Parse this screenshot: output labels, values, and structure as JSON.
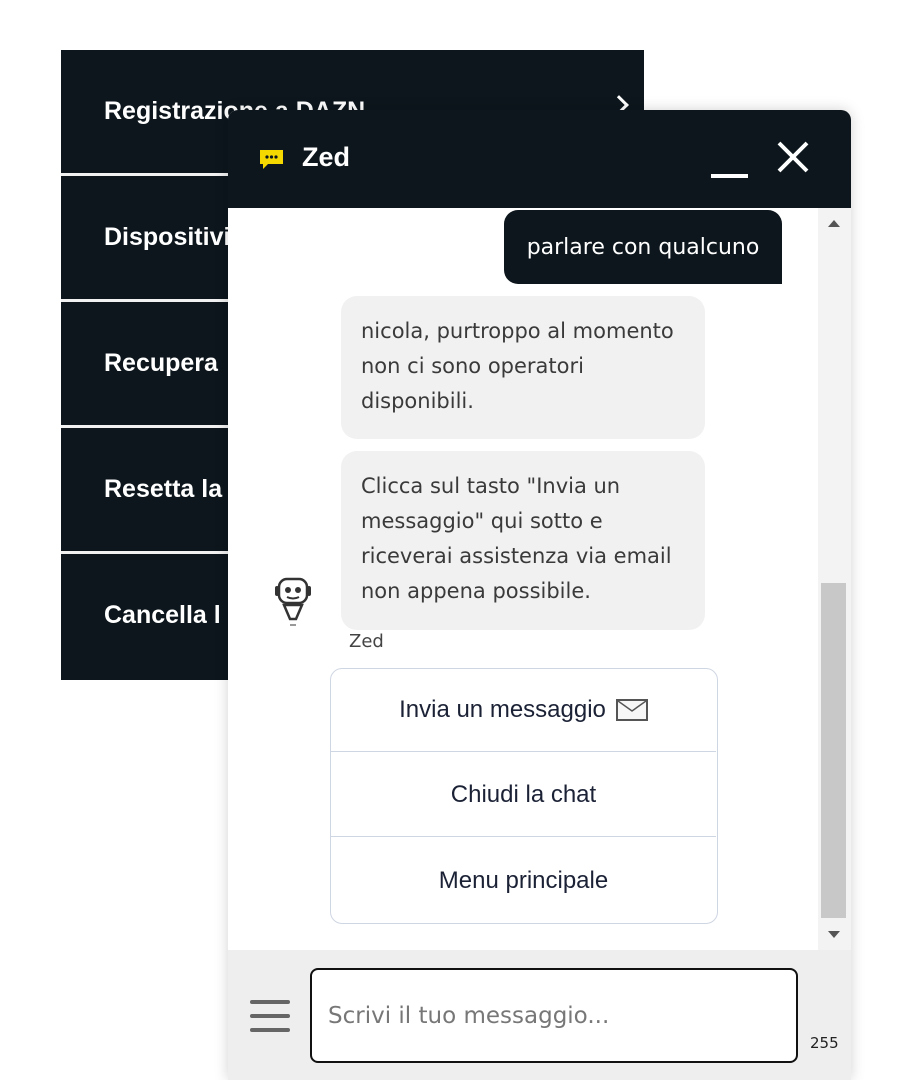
{
  "background_menu": {
    "items": [
      {
        "label": "Registrazione a DAZN"
      },
      {
        "label": "Dispositivi"
      },
      {
        "label": "Recupera"
      },
      {
        "label": "Resetta la"
      },
      {
        "label": "Cancella l"
      }
    ],
    "chevron_icon": "chevron-right-icon"
  },
  "chat": {
    "title": "Zed",
    "header_icon": "chat-bubble-icon",
    "accent_color": "#f5d800",
    "header_color": "#0c161c",
    "messages": [
      {
        "from": "user",
        "text": "parlare con qualcuno"
      },
      {
        "from": "bot",
        "text": "nicola, purtroppo al momento non ci sono operatori disponibili."
      },
      {
        "from": "bot",
        "text": "Clicca sul tasto \"Invia un messaggio\" qui sotto e riceverai assistenza via email non appena possibile."
      }
    ],
    "bot_name": "Zed",
    "quick_replies": [
      {
        "label": "Invia un messaggio",
        "icon": "envelope-icon"
      },
      {
        "label": "Chiudi la chat"
      },
      {
        "label": "Menu principale"
      }
    ],
    "input": {
      "placeholder": "Scrivi il tuo messaggio...",
      "value": "",
      "char_limit": "255"
    }
  }
}
